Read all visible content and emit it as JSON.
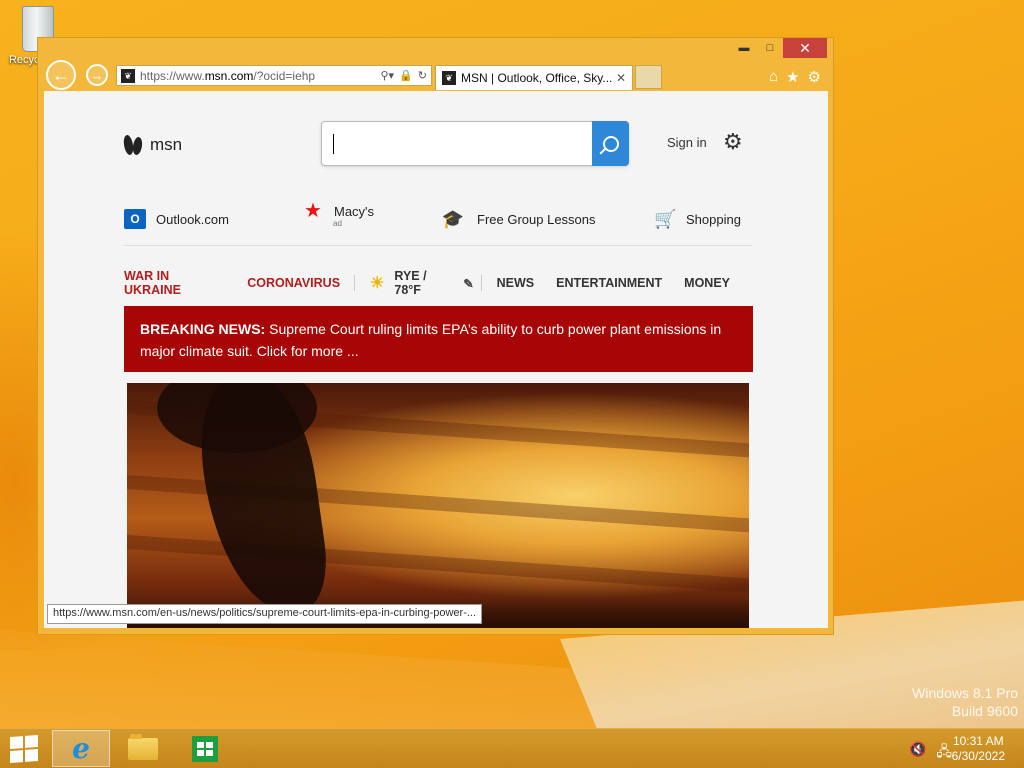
{
  "desktop": {
    "recycle_bin_label": "Recycle Bin",
    "watermark_line1": "Windows 8.1 Pro",
    "watermark_line2": "Build 9600"
  },
  "browser": {
    "address_url_prefix": "https://www.",
    "address_url_domain": "msn.com",
    "address_url_path": "/?ocid=iehp",
    "tab_title": "MSN | Outlook, Office, Sky...",
    "status_url": "https://www.msn.com/en-us/news/politics/supreme-court-limits-epa-in-curbing-power-..."
  },
  "msn": {
    "logo_text": "msn",
    "search_value": "",
    "sign_in": "Sign in",
    "quicklinks": {
      "outlook": "Outlook.com",
      "macys": "Macy's",
      "macys_ad": "ad",
      "group_lessons": "Free Group Lessons",
      "shopping": "Shopping"
    },
    "nav": {
      "war": "WAR IN UKRAINE",
      "corona": "CORONAVIRUS",
      "weather": "RYE / 78°F",
      "news": "NEWS",
      "entertainment": "ENTERTAINMENT",
      "money": "MONEY"
    },
    "breaking": {
      "label": "BREAKING NEWS:",
      "text": " Supreme Court ruling limits EPA’s ability to curb power plant emissions in major climate suit. Click for more ..."
    }
  },
  "taskbar": {
    "time": "10:31 AM",
    "date": "6/30/2022"
  },
  "colors": {
    "breaking_bg": "#a80606",
    "nav_red": "#b51c1c",
    "search_button": "#2f87d8",
    "window_frame": "#f3b73a"
  }
}
